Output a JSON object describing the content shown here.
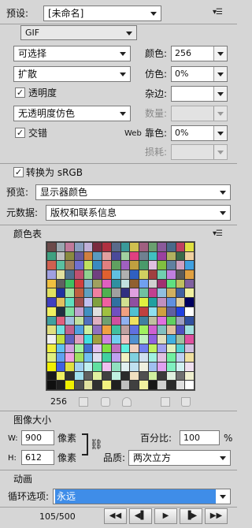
{
  "preset": {
    "label": "预设:",
    "value": "[未命名]"
  },
  "format": "GIF",
  "reduction_algorithm": "可选择",
  "colors": {
    "label": "颜色:",
    "value": "256"
  },
  "dither_algorithm": "扩散",
  "dither": {
    "label": "仿色:",
    "value": "0%"
  },
  "transparency": {
    "label": "透明度",
    "checked": true
  },
  "matte": {
    "label": "杂边:",
    "value": ""
  },
  "transparency_dither": "无透明度仿色",
  "amount": {
    "label": "数量:",
    "value": ""
  },
  "interlaced": {
    "label": "交错",
    "checked": true
  },
  "web_snap": {
    "label_prefix": "Web",
    "label": "靠色:",
    "value": "0%"
  },
  "lossy": {
    "label": "损耗:",
    "value": ""
  },
  "convert_srgb": {
    "label": "转换为 sRGB",
    "checked": true
  },
  "preview": {
    "label": "预览:",
    "value": "显示器颜色"
  },
  "metadata": {
    "label": "元数据:",
    "value": "版权和联系信息"
  },
  "color_table": {
    "title": "颜色表",
    "count": "256"
  },
  "palette": [
    "#6b4a4a",
    "#9aa8b0",
    "#c07a9a",
    "#8a9fc0",
    "#c0b0d8",
    "#7a2a40",
    "#b03040",
    "#5a6a8a",
    "#3a9a9a",
    "#d0c050",
    "#a06080",
    "#6aa070",
    "#8a5a9a",
    "#4a6a8a",
    "#c04060",
    "#e0e040",
    "#40a080",
    "#c0c0c0",
    "#8a8a40",
    "#6a5a9a",
    "#d08040",
    "#5a9ac0",
    "#e0a0a0",
    "#4a4a9a",
    "#a0d0a0",
    "#e04080",
    "#708090",
    "#40c0c0",
    "#9a40a0",
    "#b0b060",
    "#3a6a4a",
    "#f0d0a0",
    "#d06050",
    "#5ac0a0",
    "#a08060",
    "#7070d0",
    "#c0e060",
    "#3a8ac0",
    "#e08080",
    "#60a060",
    "#a060c0",
    "#c0a040",
    "#4a9a6a",
    "#e0c0e0",
    "#80c040",
    "#6080a0",
    "#d0a0c0",
    "#40a0e0",
    "#a0a0e0",
    "#e0e0a0",
    "#507090",
    "#c05070",
    "#90d090",
    "#704080",
    "#e06030",
    "#60c0e0",
    "#b0b0b0",
    "#3060c0",
    "#d0d060",
    "#a04040",
    "#70d0b0",
    "#c080e0",
    "#5a5a5a",
    "#e0a040",
    "#f0c040",
    "#606060",
    "#40c060",
    "#d04040",
    "#80b0d0",
    "#a0a060",
    "#e060c0",
    "#3090a0",
    "#c0e0e0",
    "#906030",
    "#70a0f0",
    "#d0d0d0",
    "#a03070",
    "#60e080",
    "#c0c060",
    "#8060a0",
    "#e0e060",
    "#2030a0",
    "#a0e0a0",
    "#c06040",
    "#60a0c0",
    "#f080a0",
    "#50b050",
    "#a0a0a0",
    "#303080",
    "#e0a0e0",
    "#70c0a0",
    "#c04090",
    "#90c0e0",
    "#d0b060",
    "#4060a0",
    "#f0f0a0",
    "#4040c0",
    "#e0c060",
    "#60e0c0",
    "#a05050",
    "#c0c0f0",
    "#80a040",
    "#f060a0",
    "#3070a0",
    "#d0e090",
    "#9050a0",
    "#e0f040",
    "#20a0a0",
    "#c090c0",
    "#6090e0",
    "#e0d0a0",
    "#000060",
    "#f0f060",
    "#203040",
    "#80e0a0",
    "#c0a0d0",
    "#4090c0",
    "#e0e0e0",
    "#a0c040",
    "#7050c0",
    "#f0a080",
    "#50c0d0",
    "#c04040",
    "#90e0f0",
    "#d0a040",
    "#6060a0",
    "#2040e0",
    "#ffffff",
    "#40a0a0",
    "#e06080",
    "#a0c0e0",
    "#c0e0a0",
    "#5070c0",
    "#e0b0c0",
    "#70a070",
    "#d050a0",
    "#90b0f0",
    "#f0e060",
    "#4080a0",
    "#c0c0a0",
    "#e070e0",
    "#60d060",
    "#a0a0c0",
    "#3050a0",
    "#e0e080",
    "#70e0e0",
    "#c06090",
    "#50a0e0",
    "#d0f0a0",
    "#9070c0",
    "#f0a040",
    "#40c0a0",
    "#c0a0a0",
    "#6070e0",
    "#a0f060",
    "#d060d0",
    "#80c0c0",
    "#e0c0a0",
    "#5050c0",
    "#a0e0e0",
    "#f0f0f0",
    "#c0e040",
    "#6060c0",
    "#e0a0c0",
    "#40e0e0",
    "#a0a040",
    "#d080e0",
    "#70d0f0",
    "#f0c0c0",
    "#5090d0",
    "#c0f0c0",
    "#9060e0",
    "#e0e0c0",
    "#40b0e0",
    "#a0c0a0",
    "#e050a0",
    "#f0f040",
    "#60c0f0",
    "#d0a0e0",
    "#a0f0a0",
    "#4070d0",
    "#e0c0f0",
    "#80e040",
    "#c070c0",
    "#60f0e0",
    "#f0d0c0",
    "#7080f0",
    "#c0f060",
    "#a0a0f0",
    "#e0f0c0",
    "#50d0d0",
    "#d0c0e0",
    "#e0f080",
    "#60a0f0",
    "#f0a0e0",
    "#a0e060",
    "#70c0f0",
    "#e0e0f0",
    "#40d0a0",
    "#c0a0f0",
    "#f0f0c0",
    "#80d0e0",
    "#d0e0f0",
    "#a0f0e0",
    "#e0c0e0",
    "#70f0a0",
    "#c0d0f0",
    "#f0e0a0",
    "#f0f000",
    "#4060e0",
    "#e0e040",
    "#a0d0f0",
    "#c0f0f0",
    "#60e0a0",
    "#f0c0f0",
    "#90e0c0",
    "#e0f0f0",
    "#c0e0f0",
    "#f0f0e0",
    "#a0c0f0",
    "#e0a0f0",
    "#80f0c0",
    "#d0f0f0",
    "#f0e0f0",
    "#1a1a1a",
    "#f0f060",
    "#303030",
    "#a0e0f0",
    "#606060",
    "#e0f0a0",
    "#404040",
    "#c0f0e0",
    "#2a2a2a",
    "#f0e0c0",
    "#505050",
    "#d0f0a0",
    "#3a3a3a",
    "#e0f0e0",
    "#707070",
    "#f0f0d0",
    "#101010",
    "#202020",
    "#f0f000",
    "#505050",
    "#e0e0a0",
    "#303030",
    "#f0f080",
    "#202020",
    "#c0c0c0",
    "#404040",
    "#f0f0a0",
    "#181818",
    "#d0d0d0",
    "#2a2a2a",
    "#e0e0e0",
    "#ffffff"
  ],
  "image_size": {
    "title": "图像大小",
    "w_label": "W:",
    "w_value": "900",
    "w_unit": "像素",
    "h_label": "H:",
    "h_value": "612",
    "h_unit": "像素",
    "percent_label": "百分比:",
    "percent_value": "100",
    "percent_unit": "%",
    "quality_label": "品质:",
    "quality_value": "两次立方"
  },
  "animation": {
    "title": "动画",
    "loop_label": "循环选项:",
    "loop_value": "永远",
    "frame_counter": "105/500"
  }
}
